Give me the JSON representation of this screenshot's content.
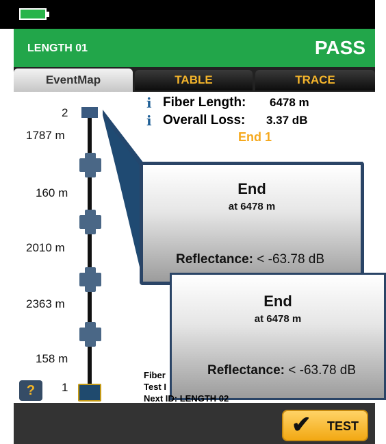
{
  "status_bar": {
    "battery_icon": "battery-icon"
  },
  "header": {
    "title": "LENGTH 01",
    "result": "PASS"
  },
  "tabs": [
    {
      "label": "EventMap",
      "active": true
    },
    {
      "label": "TABLE",
      "active": false
    },
    {
      "label": "TRACE",
      "active": false
    }
  ],
  "event_map": {
    "top_index": "2",
    "bottom_index": "1",
    "segments": [
      "1787 m",
      "160 m",
      "2010 m",
      "2363 m",
      "158 m"
    ]
  },
  "summary": {
    "fiber_length_label": "Fiber Length:",
    "fiber_length_value": "6478 m",
    "overall_loss_label": "Overall Loss:",
    "overall_loss_value": "3.37 dB",
    "end_label": "End 1"
  },
  "popup_back": {
    "title": "End",
    "position": "at 6478 m",
    "reflectance_label": "Reflectance:",
    "reflectance_value": "< -63.78 dB"
  },
  "popup_front": {
    "title": "End",
    "position": "at 6478 m",
    "reflectance_label": "Reflectance:",
    "reflectance_value": "< -63.78 dB"
  },
  "footer_info": {
    "line1": "Fiber",
    "line2": "Test I",
    "line3": "Next ID: LENGTH 02"
  },
  "buttons": {
    "help": "?",
    "test": "TEST"
  },
  "colors": {
    "header": "#22a64a",
    "tab_text": "#f5b52b",
    "accent_end": "#f5a81c",
    "info_icon": "#1f5f96"
  }
}
